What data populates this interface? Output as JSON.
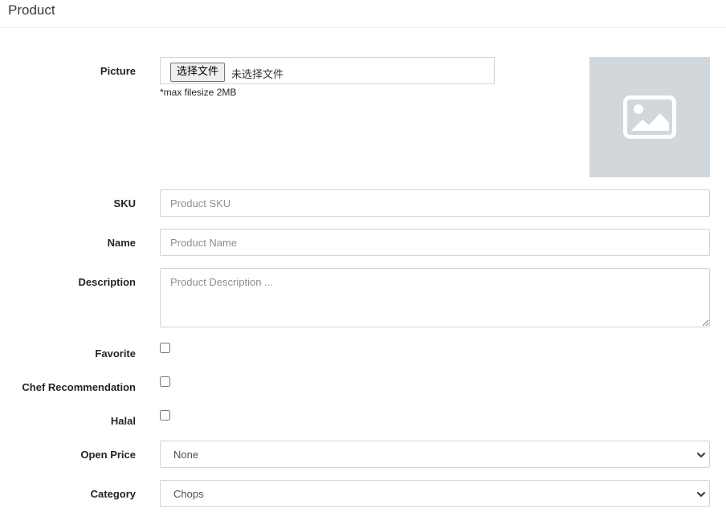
{
  "header": {
    "title": "Product"
  },
  "picture": {
    "label": "Picture",
    "button_label": "选择文件",
    "status": "未选择文件",
    "help": "*max filesize 2MB",
    "preview_icon": "image-placeholder-icon"
  },
  "sku": {
    "label": "SKU",
    "placeholder": "Product SKU",
    "value": ""
  },
  "name": {
    "label": "Name",
    "placeholder": "Product Name",
    "value": ""
  },
  "description": {
    "label": "Description",
    "placeholder": "Product Description ...",
    "value": ""
  },
  "favorite": {
    "label": "Favorite",
    "checked": false
  },
  "chef_recommendation": {
    "label": "Chef Recommendation",
    "checked": false
  },
  "halal": {
    "label": "Halal",
    "checked": false
  },
  "open_price": {
    "label": "Open Price",
    "selected": "None"
  },
  "category": {
    "label": "Category",
    "selected": "Chops"
  },
  "colors": {
    "border": "#ced4da",
    "preview_bg": "#d1d7db",
    "placeholder": "#8a8f94"
  }
}
